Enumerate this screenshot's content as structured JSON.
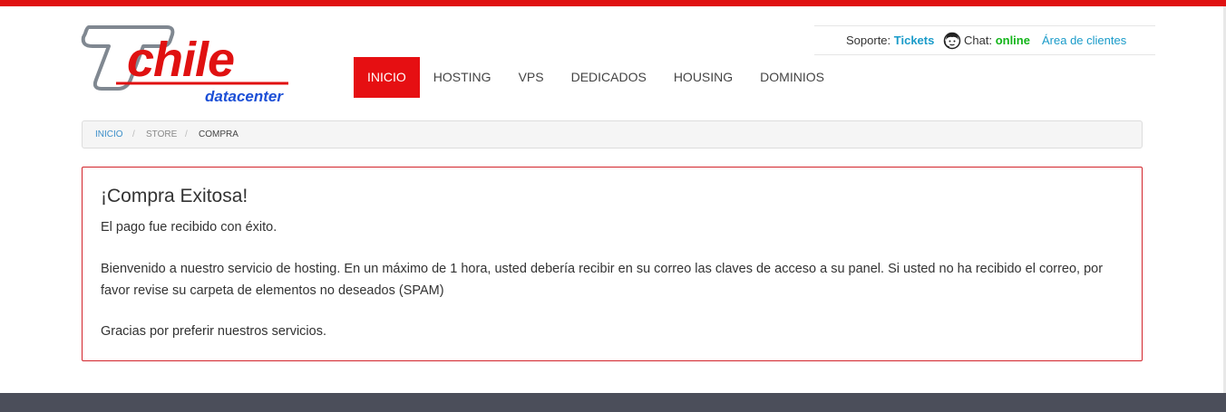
{
  "colors": {
    "accent_red": "#e60f12",
    "link_blue": "#1a9bc9",
    "online_green": "#13b51a",
    "logo_blue": "#1c4fd6",
    "footer": "#4b4e5a"
  },
  "logo": {
    "brand_main": "chile",
    "brand_sub": "datacenter"
  },
  "nav": {
    "items": [
      {
        "label": "INICIO",
        "active": true
      },
      {
        "label": "HOSTING"
      },
      {
        "label": "VPS"
      },
      {
        "label": "DEDICADOS"
      },
      {
        "label": "HOUSING"
      },
      {
        "label": "DOMINIOS"
      }
    ]
  },
  "support": {
    "support_label": "Soporte: ",
    "tickets_link": "Tickets",
    "chat_icon": "operator-headset-icon",
    "chat_label": "Chat: ",
    "chat_status": "online",
    "client_area_link": "Área de clientes"
  },
  "breadcrumb": {
    "items": [
      "INICIO",
      "STORE",
      "COMPRA"
    ],
    "separator": "/"
  },
  "panel": {
    "title": "¡Compra Exitosa!",
    "paragraph1": "El pago fue recibido con éxito.",
    "paragraph2": "Bienvenido a nuestro servicio de hosting. En un máximo de 1 hora, usted debería recibir en su correo las claves de acceso a su panel. Si usted no ha recibido el correo, por favor revise su carpeta de elementos no deseados (SPAM)",
    "paragraph3": "Gracias por preferir nuestros servicios."
  }
}
